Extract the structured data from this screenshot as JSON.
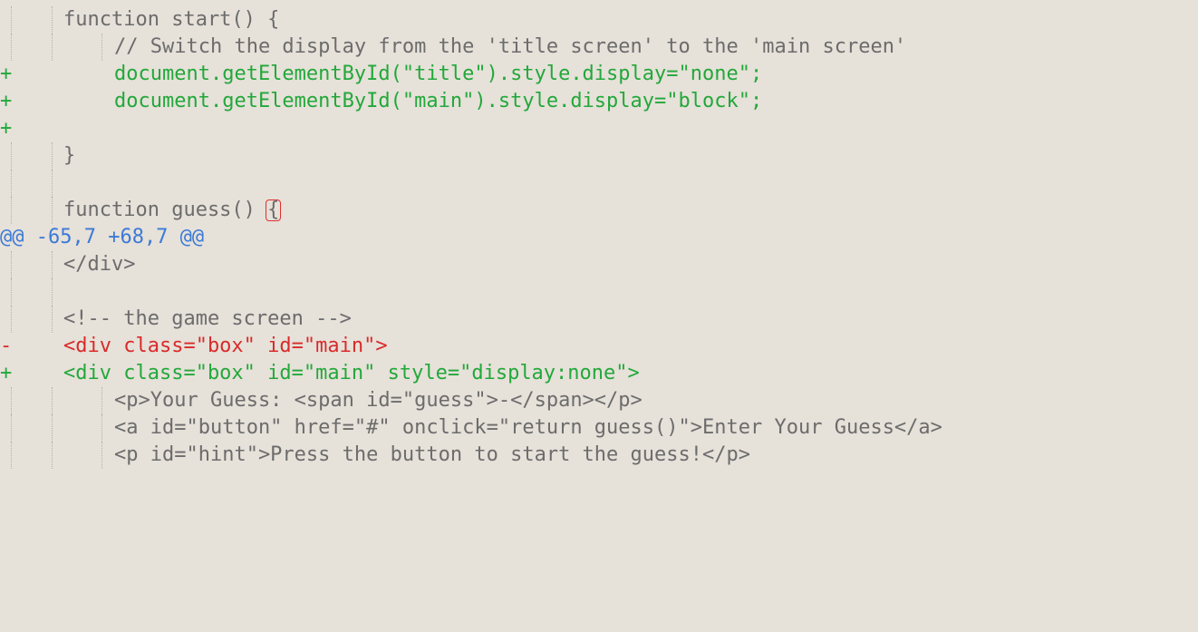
{
  "diff": {
    "lines": [
      {
        "kind": "context",
        "marker": "",
        "indent": 1,
        "text": "function start() {"
      },
      {
        "kind": "context",
        "marker": "",
        "indent": 2,
        "text": "// Switch the display from the 'title screen' to the 'main screen'"
      },
      {
        "kind": "added",
        "marker": "+",
        "indent": 2,
        "text": "document.getElementById(\"title\").style.display=\"none\";"
      },
      {
        "kind": "added",
        "marker": "+",
        "indent": 2,
        "text": "document.getElementById(\"main\").style.display=\"block\";"
      },
      {
        "kind": "added",
        "marker": "+",
        "indent": 0,
        "text": ""
      },
      {
        "kind": "context",
        "marker": "",
        "indent": 1,
        "text": "}"
      },
      {
        "kind": "context",
        "marker": "",
        "indent": 1,
        "text": ""
      },
      {
        "kind": "context",
        "marker": "",
        "indent": 1,
        "text": "function guess() ",
        "highlight": "{"
      },
      {
        "kind": "hunk",
        "text": "@@ -65,7 +68,7 @@"
      },
      {
        "kind": "context",
        "marker": "",
        "indent": 1,
        "text": "</div>"
      },
      {
        "kind": "context",
        "marker": "",
        "indent": 1,
        "text": ""
      },
      {
        "kind": "context",
        "marker": "",
        "indent": 1,
        "text": "<!-- the game screen -->"
      },
      {
        "kind": "removed",
        "marker": "-",
        "indent": 1,
        "text": "<div class=\"box\" id=\"main\">"
      },
      {
        "kind": "added",
        "marker": "+",
        "indent": 1,
        "text": "<div class=\"box\" id=\"main\" style=\"display:none\">"
      },
      {
        "kind": "context",
        "marker": "",
        "indent": 2,
        "text": "<p>Your Guess: <span id=\"guess\">-</span></p>"
      },
      {
        "kind": "context",
        "marker": "",
        "indent": 2,
        "text": "<a id=\"button\" href=\"#\" onclick=\"return guess()\">Enter Your Guess</a>"
      },
      {
        "kind": "context",
        "marker": "",
        "indent": 2,
        "text": "<p id=\"hint\">Press the button to start the guess!</p>"
      }
    ]
  }
}
